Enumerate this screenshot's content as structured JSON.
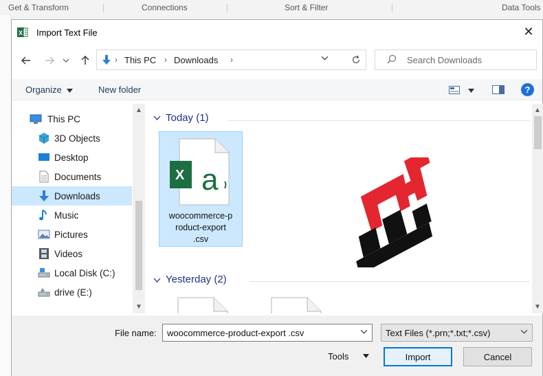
{
  "ribbon": {
    "items": [
      "Get & Transform",
      "Connections",
      "Sort & Filter",
      "Data Tools"
    ]
  },
  "dialog": {
    "title": "Import Text File",
    "close_glyph": "✕"
  },
  "navigation": {
    "breadcrumb": [
      "This PC",
      "Downloads"
    ],
    "search_placeholder": "Search Downloads"
  },
  "toolbar": {
    "organize_label": "Organize",
    "new_folder_label": "New folder"
  },
  "sidebar": {
    "items": [
      {
        "label": "This PC",
        "icon": "computer-icon",
        "selected": false
      },
      {
        "label": "3D Objects",
        "icon": "cube-icon",
        "selected": false
      },
      {
        "label": "Desktop",
        "icon": "desktop-icon",
        "selected": false
      },
      {
        "label": "Documents",
        "icon": "document-icon",
        "selected": false
      },
      {
        "label": "Downloads",
        "icon": "download-arrow-icon",
        "selected": true
      },
      {
        "label": "Music",
        "icon": "music-note-icon",
        "selected": false
      },
      {
        "label": "Pictures",
        "icon": "picture-icon",
        "selected": false
      },
      {
        "label": "Videos",
        "icon": "film-icon",
        "selected": false
      },
      {
        "label": "Local Disk (C:)",
        "icon": "drive-icon",
        "selected": false
      },
      {
        "label": "drive (E:)",
        "icon": "drive-icon",
        "selected": false
      }
    ]
  },
  "files": {
    "groups": [
      {
        "header": "Today (1)",
        "items": [
          {
            "name": "woocommerce-product-export .csv",
            "name_lines": [
              "woocommerce-p",
              "roduct-export",
              ".csv"
            ],
            "selected": true
          }
        ]
      },
      {
        "header": "Yesterday (2)",
        "items": []
      }
    ]
  },
  "footer": {
    "file_name_label": "File name:",
    "file_name_value": "woocommerce-product-export .csv",
    "file_type_value": "Text Files (*.prn;*.txt;*.csv)",
    "tools_label": "Tools",
    "import_label": "Import",
    "cancel_label": "Cancel"
  },
  "colors": {
    "accent": "#0078d7",
    "selection": "#cce8ff",
    "excel_green": "#1d6f42",
    "group_header": "#1e3287"
  }
}
